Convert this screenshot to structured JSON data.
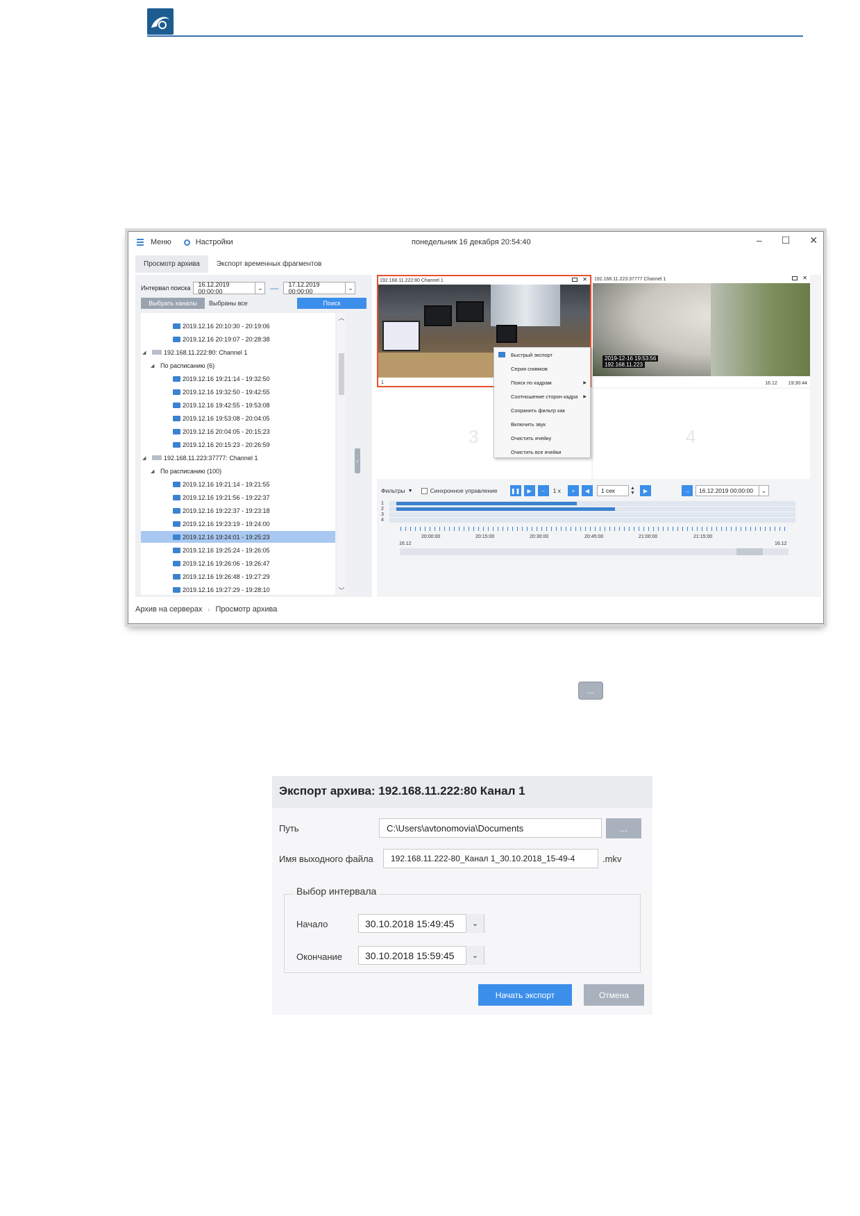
{
  "app": {
    "menu_label": "Меню",
    "settings_label": "Настройки",
    "clock": "понедельник 16 декабря 20:54:40",
    "tabs": [
      {
        "label": "Просмотр архива"
      },
      {
        "label": "Экспорт временных фрагментов"
      }
    ],
    "search": {
      "interval_label": "Интервал поиска",
      "from": "16.12.2019  00:00:00",
      "to": "17.12.2019  00:00:00",
      "choose_channels": "Выбрать каналы",
      "all_selected": "Выбраны все",
      "search_button": "Поиск"
    },
    "tree": [
      {
        "kind": "rec",
        "text": "2019.12.16   20:10:30 - 20:19:06"
      },
      {
        "kind": "rec",
        "text": "2019.12.16   20:19:07 - 20:28:38"
      },
      {
        "kind": "cam",
        "text": "192.168.11.222:80: Channel 1"
      },
      {
        "kind": "group",
        "text": "По расписанию (6)"
      },
      {
        "kind": "rec",
        "text": "2019.12.16   19:21:14 - 19:32:50"
      },
      {
        "kind": "rec",
        "text": "2019.12.16   19:32:50 - 19:42:55"
      },
      {
        "kind": "rec",
        "text": "2019.12.16   19:42:55 - 19:53:08"
      },
      {
        "kind": "rec",
        "text": "2019.12.16   19:53:08 - 20:04:05"
      },
      {
        "kind": "rec",
        "text": "2019.12.16   20:04:05 - 20:15:23"
      },
      {
        "kind": "rec",
        "text": "2019.12.16   20:15:23 - 20:26:59"
      },
      {
        "kind": "cam",
        "text": "192.168.11.223:37777: Channel 1"
      },
      {
        "kind": "group",
        "text": "По расписанию (100)"
      },
      {
        "kind": "rec",
        "text": "2019.12.16   19:21:14 - 19:21:55"
      },
      {
        "kind": "rec",
        "text": "2019.12.16   19:21:56 - 19:22:37"
      },
      {
        "kind": "rec",
        "text": "2019.12.16   19:22:37 - 19:23:18"
      },
      {
        "kind": "rec",
        "text": "2019.12.16   19:23:19 - 19:24:00"
      },
      {
        "kind": "rec",
        "text": "2019.12.16   19:24:01 - 19:25:23",
        "selected": true
      },
      {
        "kind": "rec",
        "text": "2019.12.16   19:25:24 - 19:26:05"
      },
      {
        "kind": "rec",
        "text": "2019.12.16   19:26:06 - 19:26:47"
      },
      {
        "kind": "rec",
        "text": "2019.12.16   19:26:48 - 19:27:29"
      },
      {
        "kind": "rec",
        "text": "2019.12.16   19:27:29 - 19:28:10"
      }
    ],
    "cells": {
      "cell1_caption": "192.168.11.222:80   Channel 1",
      "cell1_index": "1",
      "cell2_caption": "192.168.11.223:37777   Channel 1",
      "cell2_overlay_time": "2019-12-16 19:53:56",
      "cell2_overlay_ip": "192.168.11.223",
      "cell2_date": "16.12",
      "cell2_time": "19:30:44",
      "cell3_index": "3",
      "cell4_index": "4"
    },
    "context_menu": [
      {
        "label": "Быстрый экспорт",
        "submenu": false
      },
      {
        "label": "Серия снимков",
        "submenu": false
      },
      {
        "label": "Поиск по кадрам",
        "submenu": true
      },
      {
        "label": "Соотношение сторон кадра",
        "submenu": true
      },
      {
        "label": "Сохранить фильтр как",
        "submenu": false
      },
      {
        "label": "Включить звук",
        "submenu": false
      },
      {
        "label": "Очистить ячейку",
        "submenu": false
      },
      {
        "label": "Очистить все ячейки",
        "submenu": false
      }
    ],
    "controls": {
      "filters": "Фильтры",
      "sync": "Синхронное управление",
      "speed": "1 x",
      "step": "1 сек",
      "goto_date": "16.12.2019  00:00:00"
    },
    "timeline": {
      "rows": [
        "1",
        "2",
        "3",
        "4"
      ],
      "ticks": [
        "20:00:00",
        "20:15:00",
        "20:30:00",
        "20:45:00",
        "21:00:00",
        "21:15:00"
      ],
      "start_date": "16.12",
      "end_date": "16.12"
    },
    "breadcrumb": [
      "Архив на серверах",
      "Просмотр архива"
    ]
  },
  "loose_button": "...",
  "dialog": {
    "title": "Экспорт архива: 192.168.11.222:80 Канал 1",
    "path_label": "Путь",
    "path_value": "C:\\Users\\avtonomovia\\Documents",
    "browse": "...",
    "filename_label": "Имя выходного файла",
    "filename_value": "192.168.11.222-80_Канал 1_30.10.2018_15-49-4",
    "extension": ".mkv",
    "interval_legend": "Выбор интервала",
    "start_label": "Начало",
    "start_value": "30.10.2018  15:49:45",
    "end_label": "Окончание",
    "end_value": "30.10.2018  15:59:45",
    "start_button": "Начать экспорт",
    "cancel_button": "Отмена"
  },
  "colors": {
    "accent": "#3b8eea",
    "selected_cell_border": "#e8502a",
    "header_rule": "#3a6fb0"
  }
}
